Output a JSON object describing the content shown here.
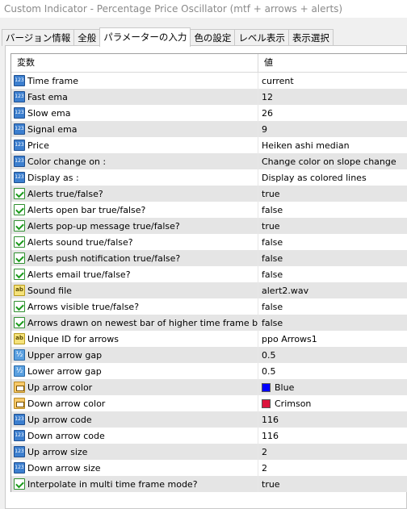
{
  "window": {
    "title": "Custom Indicator - Percentage Price Oscillator (mtf + arrows + alerts)"
  },
  "tabs": [
    {
      "label": "バージョン情報",
      "active": false
    },
    {
      "label": "全般",
      "active": false
    },
    {
      "label": "パラメーターの入力",
      "active": true
    },
    {
      "label": "色の設定",
      "active": false
    },
    {
      "label": "レベル表示",
      "active": false
    },
    {
      "label": "表示選択",
      "active": false
    }
  ],
  "grid": {
    "header": {
      "variable": "変数",
      "value": "値"
    },
    "rows": [
      {
        "name": "Time frame",
        "value": "current",
        "icon": "integer-icon"
      },
      {
        "name": "Fast ema",
        "value": "12",
        "icon": "integer-icon"
      },
      {
        "name": "Slow ema",
        "value": "26",
        "icon": "integer-icon"
      },
      {
        "name": "Signal ema",
        "value": "9",
        "icon": "integer-icon"
      },
      {
        "name": "Price",
        "value": "Heiken ashi median",
        "icon": "integer-icon"
      },
      {
        "name": "Color change on :",
        "value": "Change color on slope change",
        "icon": "integer-icon"
      },
      {
        "name": "Display as :",
        "value": "Display as colored lines",
        "icon": "integer-icon"
      },
      {
        "name": "Alerts true/false?",
        "value": "true",
        "icon": "boolean-icon"
      },
      {
        "name": "Alerts open bar true/false?",
        "value": "false",
        "icon": "boolean-icon"
      },
      {
        "name": "Alerts pop-up message true/false?",
        "value": "true",
        "icon": "boolean-icon"
      },
      {
        "name": "Alerts sound true/false?",
        "value": "false",
        "icon": "boolean-icon"
      },
      {
        "name": "Alerts push notification true/false?",
        "value": "false",
        "icon": "boolean-icon"
      },
      {
        "name": "Alerts email true/false?",
        "value": "false",
        "icon": "boolean-icon"
      },
      {
        "name": "Sound file",
        "value": "alert2.wav",
        "icon": "string-icon"
      },
      {
        "name": "Arrows visible true/false?",
        "value": "false",
        "icon": "boolean-icon"
      },
      {
        "name": "Arrows drawn on newest bar of higher time frame b...",
        "value": "false",
        "icon": "boolean-icon"
      },
      {
        "name": "Unique ID for arrows",
        "value": "ppo Arrows1",
        "icon": "string-icon"
      },
      {
        "name": "Upper arrow gap",
        "value": "0.5",
        "icon": "double-icon"
      },
      {
        "name": "Lower arrow gap",
        "value": "0.5",
        "icon": "double-icon"
      },
      {
        "name": "Up arrow color",
        "value": "Blue",
        "icon": "color-icon",
        "swatch": "#0000ff"
      },
      {
        "name": "Down arrow color",
        "value": "Crimson",
        "icon": "color-icon",
        "swatch": "#dc143c"
      },
      {
        "name": "Up arrow code",
        "value": "116",
        "icon": "integer-icon"
      },
      {
        "name": "Down arrow code",
        "value": "116",
        "icon": "integer-icon"
      },
      {
        "name": "Up arrow size",
        "value": "2",
        "icon": "integer-icon"
      },
      {
        "name": "Down arrow size",
        "value": "2",
        "icon": "integer-icon"
      },
      {
        "name": "Interpolate in multi time frame mode?",
        "value": "true",
        "icon": "boolean-icon"
      }
    ]
  }
}
